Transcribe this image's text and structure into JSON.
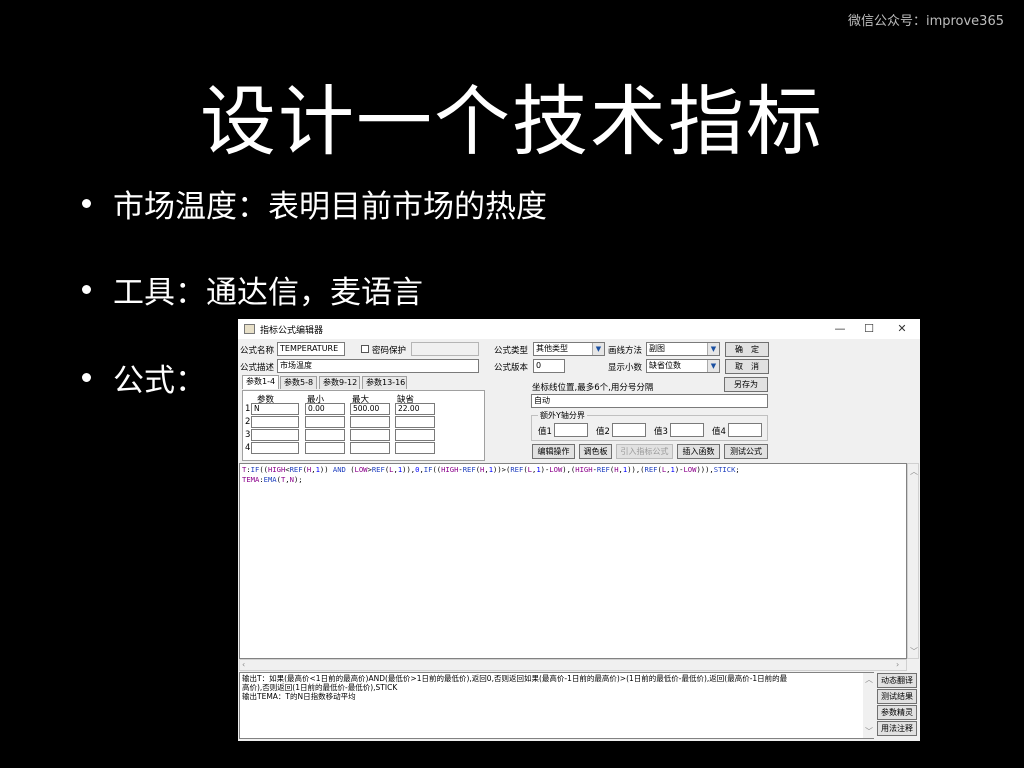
{
  "watermark": "微信公众号：improve365",
  "slide": {
    "title": "设计一个技术指标",
    "bullets": [
      "市场温度：表明目前市场的热度",
      "工具：通达信，麦语言",
      "公式："
    ]
  },
  "window": {
    "title": "指标公式编辑器",
    "controls": {
      "minimize": "—",
      "maximize": "☐",
      "close": "✕"
    },
    "form": {
      "name_label": "公式名称",
      "name_value": "TEMPERATURE",
      "password_label": "密码保护",
      "desc_label": "公式描述",
      "desc_value": "市场温度",
      "type_label": "公式类型",
      "type_value": "其他类型",
      "draw_label": "画线方法",
      "draw_value": "副图",
      "version_label": "公式版本",
      "version_value": "0",
      "decimal_label": "显示小数",
      "decimal_value": "缺省位数",
      "ok_button": "确　定",
      "cancel_button": "取　消",
      "saveas_button": "另存为",
      "coord_label": "坐标线位置,最多6个,用分号分隔",
      "coord_value": "自动",
      "yaxis_group": "额外Y轴分界",
      "yaxis_labels": [
        "值1",
        "值2",
        "值3",
        "值4"
      ]
    },
    "param_tabs": [
      "参数1-4",
      "参数5-8",
      "参数9-12",
      "参数13-16"
    ],
    "param_headers": [
      "参数",
      "最小",
      "最大",
      "缺省"
    ],
    "param_rows": [
      {
        "idx": "1",
        "name": "N",
        "min": "0.00",
        "max": "500.00",
        "def": "22.00"
      },
      {
        "idx": "2",
        "name": "",
        "min": "",
        "max": "",
        "def": ""
      },
      {
        "idx": "3",
        "name": "",
        "min": "",
        "max": "",
        "def": ""
      },
      {
        "idx": "4",
        "name": "",
        "min": "",
        "max": "",
        "def": ""
      }
    ],
    "actions": [
      "编辑操作",
      "调色板",
      "引入指标公式",
      "插入函数",
      "测试公式"
    ],
    "code_line1": "T:IF((HIGH<REF(H,1)) AND (LOW>REF(L,1)),0,IF((HIGH-REF(H,1))>(REF(L,1)-LOW),(HIGH-REF(H,1)),(REF(L,1)-LOW))),STICK;",
    "code_line2": "TEMA:EMA(T,N);",
    "output_lines": [
      "输出T：如果(最高价<1日前的最高价)AND(最低价>1日前的最低价),返回0,否则返回如果(最高价-1日前的最高价)>(1日前的最低价-最低价),返回(最高价-1日前的最",
      "高价),否则返回(1日前的最低价-最低价),STICK",
      "输出TEMA：T的N日指数移动平均"
    ],
    "side_buttons": [
      "动态翻译",
      "测试结果",
      "参数精灵",
      "用法注释"
    ]
  }
}
